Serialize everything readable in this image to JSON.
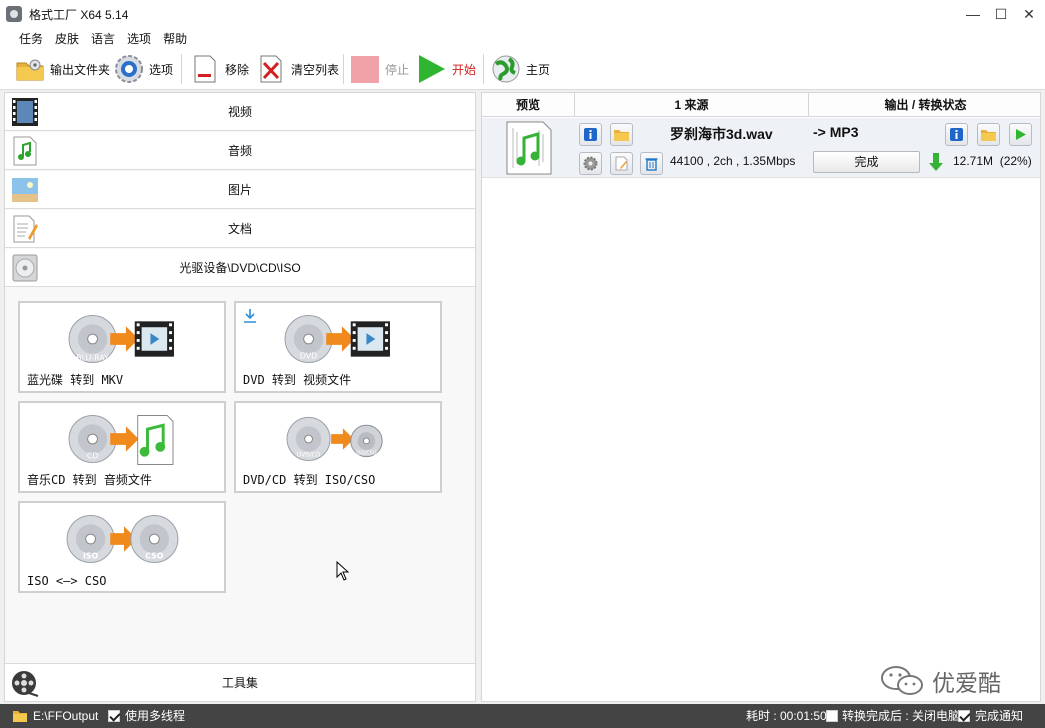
{
  "window": {
    "title": "格式工厂 X64 5.14",
    "controls": {
      "minimize": "—",
      "maximize": "☐",
      "close": "✕"
    }
  },
  "menu": [
    "任务",
    "皮肤",
    "语言",
    "选项",
    "帮助"
  ],
  "toolbar": {
    "output_folder": "输出文件夹",
    "options": "选项",
    "remove": "移除",
    "clear_list": "清空列表",
    "stop": "停止",
    "start": "开始",
    "home": "主页"
  },
  "categories": {
    "video": "视频",
    "audio": "音频",
    "image": "图片",
    "document": "文档",
    "optical": "光驱设备\\DVD\\CD\\ISO",
    "tools": "工具集"
  },
  "tiles": {
    "bluray": {
      "label": "蓝光碟 转到 MKV",
      "disc": "BLU-RAY"
    },
    "dvd_video": {
      "label": "DVD 转到 视频文件",
      "disc": "DVD"
    },
    "cd_audio": {
      "label": "音乐CD 转到 音频文件",
      "disc": "CD"
    },
    "dvd_iso": {
      "label": "DVD/CD 转到 ISO/CSO",
      "disc_a": "DVD/CD",
      "disc_b": "ISO/CSO"
    },
    "iso_cso": {
      "label": "ISO <—> CSO",
      "disc_a": "ISO",
      "disc_b": "CSO"
    }
  },
  "task_table": {
    "headers": {
      "preview": "预览",
      "source": "1 来源",
      "output": "输出 / 转换状态"
    },
    "rows": [
      {
        "filename": "罗刹海市3d.wav",
        "info": "44100 , 2ch , 1.35Mbps",
        "target": "-> MP3",
        "status": "完成",
        "output_size": "12.71M",
        "ratio": "(22%)"
      }
    ]
  },
  "watermark": {
    "text": "优爱酷"
  },
  "statusbar": {
    "output_path": "E:\\FFOutput",
    "multithread": "使用多线程",
    "multithread_checked": true,
    "elapsed": "耗时 : 00:01:50",
    "after_convert": "转换完成后 : 关闭电脑",
    "after_convert_checked": false,
    "notify": "完成通知",
    "notify_checked": true
  },
  "colors": {
    "start_green": "#2fb52f",
    "stop_pink": "#f0a2a8",
    "status_bar": "#444444",
    "arrow_orange": "#f08a1c"
  }
}
